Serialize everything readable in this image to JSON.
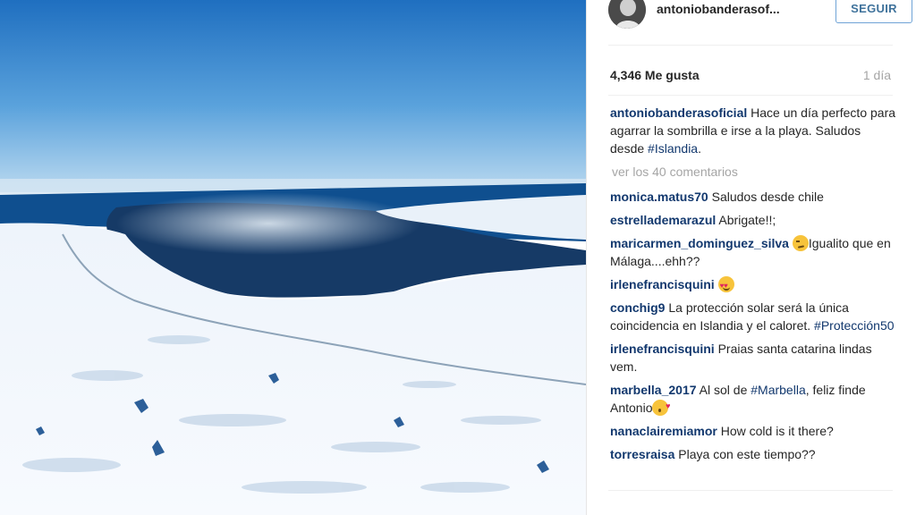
{
  "post": {
    "image_alt": "Aerial view of snow-covered Iceland coast with sea and clouds",
    "author": "antoniobanderasof...",
    "follow_label": "SEGUIR",
    "likes": "4,346 Me gusta",
    "time": "1 día",
    "caption": {
      "user": "antoniobanderasoficial",
      "text": "Hace un día perfecto para agarrar la sombrilla e irse a la playa. Saludos desde ",
      "hashtag": "#Islandia",
      "end": "."
    },
    "more_comments": "ver los 40 comentarios"
  },
  "comments": [
    {
      "user": "monica.matus70",
      "text": "Saludos desde chile"
    },
    {
      "user": "estrellademarazul",
      "text": "Abrigate!!;"
    },
    {
      "user": "maricarmen_dominguez_silva",
      "emoji": "smirk-emoji",
      "text": "Igualito que en Málaga....ehh??"
    },
    {
      "user": "irlenefrancisquini",
      "emoji": "heart-eyes-emoji"
    },
    {
      "user": "conchig9",
      "text": "La protección solar será la única coincidencia en Islandia y el caloret.",
      "hashtag": "#Protección50"
    },
    {
      "user": "irlenefrancisquini",
      "text": "Praias santa catarina lindas vem."
    },
    {
      "user": "marbella_2017",
      "text_pre": "Al sol de ",
      "hashtag": "#Marbella",
      "text_post": ", feliz finde Antonio",
      "emoji": "kiss-emoji"
    },
    {
      "user": "nanaclairemiamor",
      "text": "How cold is it there?"
    },
    {
      "user": "torresraisa",
      "text": "Playa con este tiempo??"
    }
  ]
}
